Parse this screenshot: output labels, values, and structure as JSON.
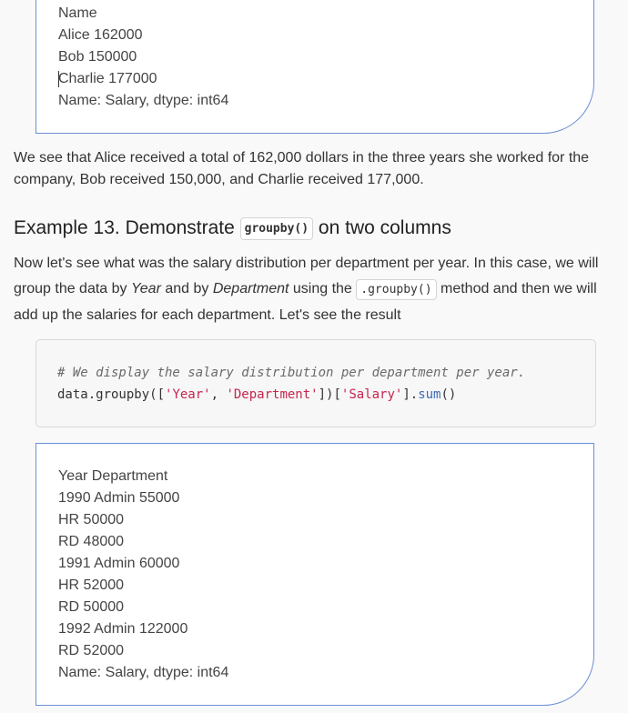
{
  "output1": {
    "lines": [
      "Name",
      "Alice 162000",
      "Bob 150000",
      "Charlie 177000",
      "Name: Salary, dtype: int64"
    ]
  },
  "paragraph1": "We see that Alice received a total of 162,000 dollars in the three years she worked for the company, Bob received 150,000, and Charlie received 177,000.",
  "heading": {
    "prefix": "Example 13. Demonstrate ",
    "code": "groupby()",
    "suffix": " on two columns"
  },
  "paragraph2": {
    "part1": "Now let's see what was the salary distribution per department per year. In this case, we will group the data by ",
    "em1": "Year",
    "part2": " and by ",
    "em2": "Department",
    "part3": " using the ",
    "code": ".groupby()",
    "part4": " method and then we will add up the salaries for each department. Let's see the result"
  },
  "code_block": {
    "comment": "# We display the salary distribution per department per year.",
    "line2": {
      "t1": "data.groupby([",
      "s1": "'Year'",
      "t2": ", ",
      "s2": "'Department'",
      "t3": "])[",
      "s3": "'Salary'",
      "t4": "].",
      "fn": "sum",
      "t5": "()"
    }
  },
  "output2": {
    "lines": [
      "Year Department",
      "1990 Admin 55000",
      "HR 50000",
      "RD 48000",
      "1991 Admin 60000",
      "HR 52000",
      "RD 50000",
      "1992 Admin 122000",
      "RD 52000",
      "Name: Salary, dtype: int64"
    ]
  }
}
